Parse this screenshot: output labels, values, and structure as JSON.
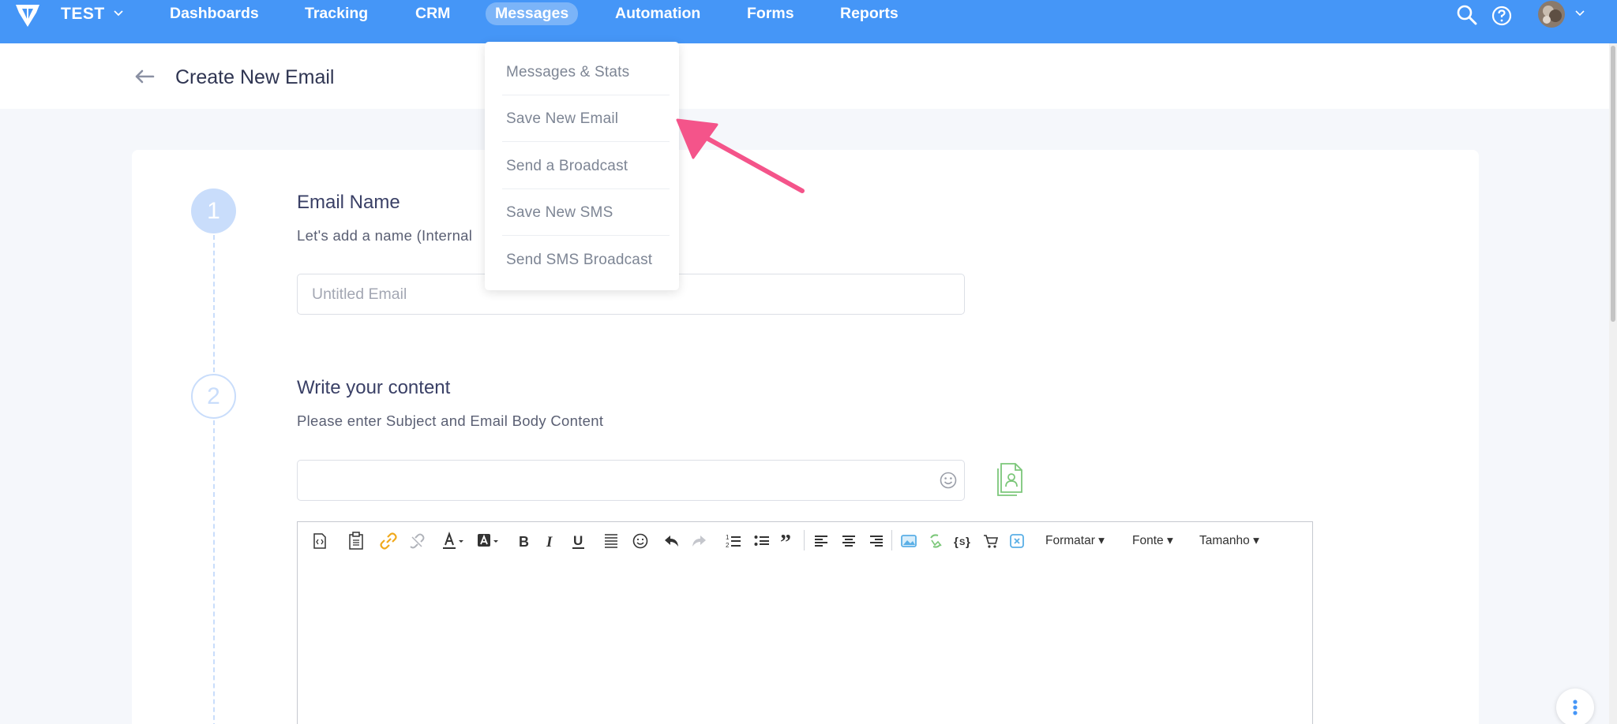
{
  "nav": {
    "brand": "TEST",
    "items": [
      "Dashboards",
      "Tracking",
      "CRM",
      "Messages",
      "Automation",
      "Forms",
      "Reports"
    ],
    "active": "Messages"
  },
  "header": {
    "title": "Create New Email"
  },
  "dropdown": {
    "items": [
      "Messages & Stats",
      "Save New Email",
      "Send a Broadcast",
      "Save New SMS",
      "Send SMS Broadcast"
    ]
  },
  "steps": [
    {
      "number": "1",
      "title": "Email Name",
      "subtitle": "Let's add a name (Internal"
    },
    {
      "number": "2",
      "title": "Write your content",
      "subtitle": "Please enter Subject and Email Body Content"
    }
  ],
  "email_name": {
    "placeholder": "Untitled Email",
    "value": ""
  },
  "subject": {
    "value": ""
  },
  "editor": {
    "format_label": "Formatar",
    "font_label": "Fonte",
    "size_label": "Tamanho"
  },
  "colors": {
    "nav_bg": "#4596f7",
    "step_circle": "#c9ddfb",
    "annotation_arrow": "#f4548a",
    "link_icon": "#f0a91c"
  }
}
